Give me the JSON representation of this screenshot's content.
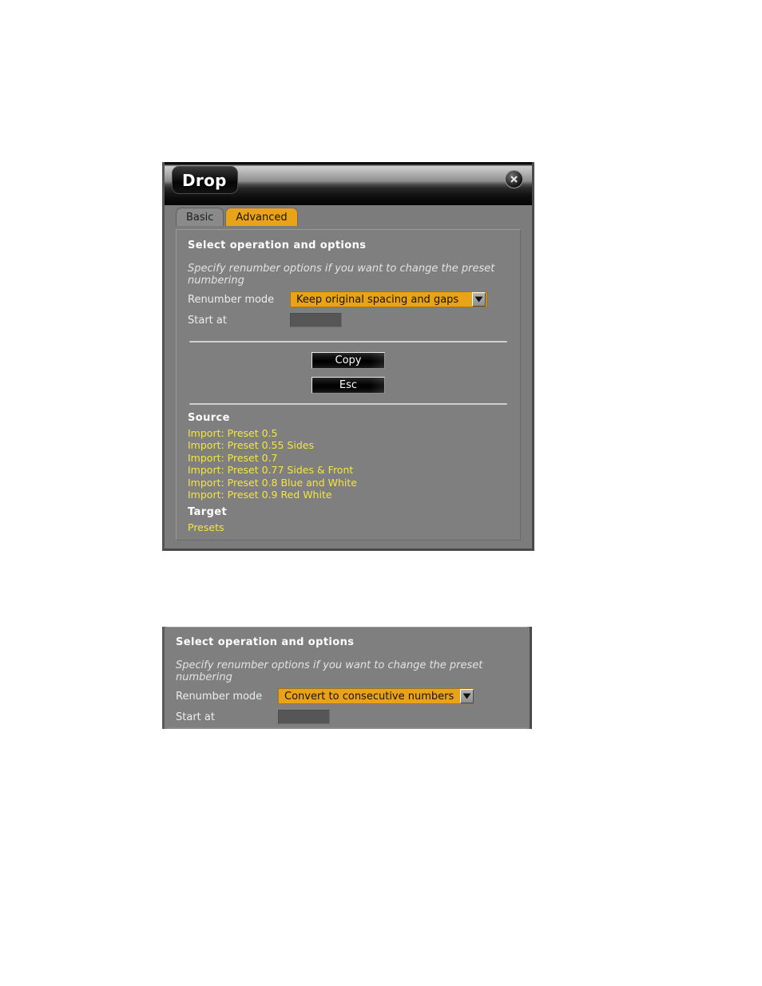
{
  "dialog": {
    "title": "Drop",
    "close_icon": "close-circle-icon",
    "tabs": [
      {
        "label": "Basic",
        "active": false
      },
      {
        "label": "Advanced",
        "active": true
      }
    ],
    "section_heading": "Select operation and options",
    "hint": "Specify renumber options if you want to change the preset numbering",
    "fields": {
      "renumber_mode_label": "Renumber mode",
      "renumber_mode_value": "Keep original spacing and gaps",
      "dropdown_arrow_icon": "chevron-down-icon",
      "start_at_label": "Start at",
      "start_at_value": "",
      "start_at_placeholder": ""
    },
    "buttons": {
      "copy_label": "Copy",
      "esc_label": "Esc"
    },
    "source": {
      "heading": "Source",
      "items": [
        "Import: Preset 0.5",
        "Import: Preset 0.55 Sides",
        "Import: Preset 0.7",
        "Import: Preset 0.77 Sides & Front",
        "Import: Preset 0.8 Blue and White",
        "Import: Preset 0.9 Red White"
      ]
    },
    "target": {
      "heading": "Target",
      "items": [
        "Presets"
      ]
    }
  },
  "panel2": {
    "section_heading": "Select operation and options",
    "hint": "Specify renumber options if you want to change the preset numbering",
    "fields": {
      "renumber_mode_label": "Renumber mode",
      "renumber_mode_value": "Convert to consecutive numbers",
      "dropdown_arrow_icon": "chevron-down-icon",
      "start_at_label": "Start at",
      "start_at_value": "",
      "start_at_placeholder": ""
    }
  },
  "colors": {
    "accent_gold": "#e8a318",
    "list_yellow": "#f5e63c",
    "panel_gray": "#7f7f7f",
    "dialog_gray": "#7c7c7c"
  }
}
